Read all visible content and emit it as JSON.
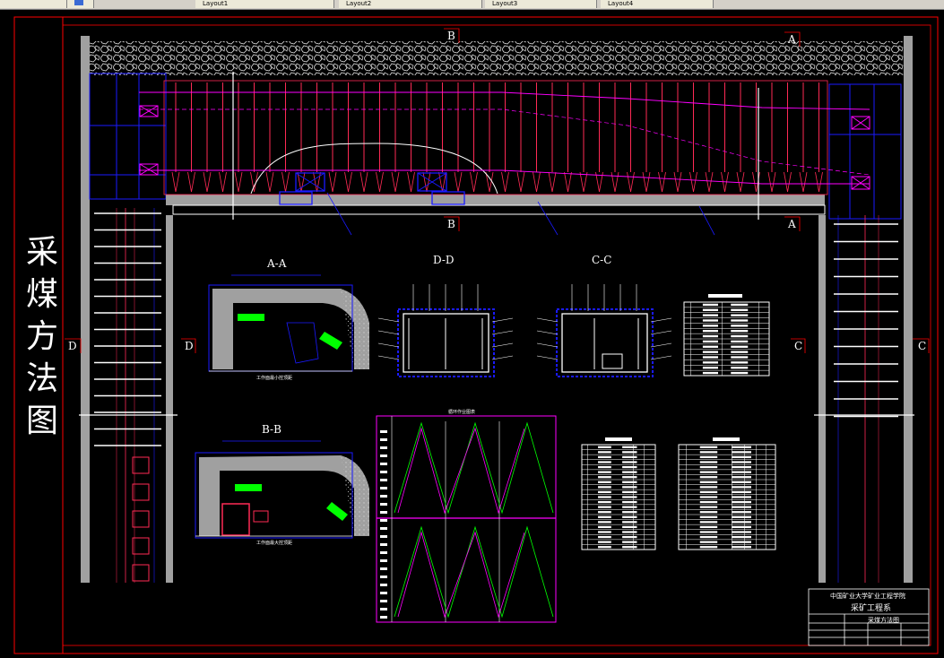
{
  "window": {
    "tabs": [
      "Layout1",
      "Layout2",
      "Layout3",
      "Layout4"
    ]
  },
  "drawing": {
    "title": "采煤方法图",
    "section_markers": [
      "A",
      "B",
      "C",
      "D"
    ],
    "sections": [
      {
        "id": "A-A",
        "label": "A-A",
        "caption": "工作面最小控顶距"
      },
      {
        "id": "B-B",
        "label": "B-B",
        "caption": "工作面最大控顶距"
      },
      {
        "id": "D-D",
        "label": "D-D"
      },
      {
        "id": "C-C",
        "label": "C-C"
      }
    ],
    "cycle_chart_title": "循环作业图表"
  },
  "title_block": {
    "school": "中国矿业大学矿业工程学院",
    "department": "采矿工程系",
    "drawing_name": "采煤方法图"
  },
  "colors": {
    "background": "#000000",
    "frame": "#ff0000",
    "support_red": "#ff2a55",
    "support_magenta": "#ff00ff",
    "roadway_blue": "#1a1aff",
    "white": "#ffffff",
    "grey": "#a0a0a0",
    "green": "#00ff00"
  }
}
